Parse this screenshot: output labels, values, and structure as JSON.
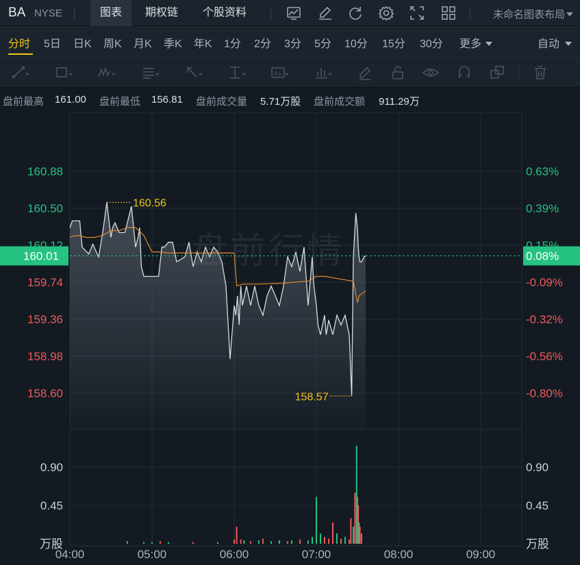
{
  "header": {
    "symbol": "BA",
    "exchange": "NYSE",
    "tabs": [
      "图表",
      "期权链",
      "个股资料"
    ],
    "active_tab": 0,
    "layout_name": "未命名图表布局"
  },
  "periods": {
    "items": [
      "分时",
      "5日",
      "日K",
      "周K",
      "月K",
      "季K",
      "年K",
      "1分",
      "2分",
      "3分",
      "5分",
      "10分",
      "15分",
      "30分"
    ],
    "more_label": "更多",
    "auto_label": "自动",
    "active": 0
  },
  "stats": {
    "high_label": "盘前最高",
    "high_value": "161.00",
    "low_label": "盘前最低",
    "low_value": "156.81",
    "vol_label": "盘前成交量",
    "vol_value": "5.71万股",
    "amount_label": "盘前成交额",
    "amount_value": "911.29万"
  },
  "chart": {
    "watermark": "盘前行情",
    "current_price_label": "160.01",
    "current_pct_label": "0.08%",
    "max_label": "160.56",
    "min_label": "158.57",
    "price_ticks": [
      "160.88",
      "160.50",
      "160.12",
      "159.74",
      "159.36",
      "158.98",
      "158.60"
    ],
    "pct_ticks": [
      "0.63%",
      "0.39%",
      "0.15%",
      "-0.09%",
      "-0.32%",
      "-0.56%",
      "-0.80%"
    ],
    "volume_ticks": [
      "0.90",
      "0.45"
    ],
    "volume_unit": "万股",
    "time_ticks": [
      "04:00",
      "05:00",
      "06:00",
      "07:00",
      "08:00",
      "09:00"
    ],
    "colors": {
      "up": "#26c281",
      "down": "#f05a5a",
      "accent": "#f0c419",
      "avg": "#e08a2e",
      "line": "#d9dde2"
    }
  },
  "chart_data": {
    "type": "line",
    "title": "",
    "xlabel": "",
    "ylabel": "",
    "ylim": [
      158.44,
      161.05
    ],
    "x_range_hours": [
      4.0,
      9.5
    ],
    "reference_price": 159.88,
    "series": [
      {
        "x": [
          4.0,
          4.03,
          4.12,
          4.15,
          4.23,
          4.28,
          4.35,
          4.4,
          4.45,
          4.5,
          4.52,
          4.55,
          4.6,
          4.67,
          4.75,
          4.8,
          4.83,
          4.85,
          4.87,
          4.9,
          5.0,
          5.08,
          5.12,
          5.15,
          5.2,
          5.25,
          5.3,
          5.4,
          5.45,
          5.5,
          5.55,
          5.6,
          5.65,
          5.7,
          5.75,
          5.8,
          5.85,
          5.9,
          5.95,
          6.0,
          6.02,
          6.04,
          6.06,
          6.08,
          6.1,
          6.15,
          6.2,
          6.25,
          6.3,
          6.35,
          6.4,
          6.45,
          6.5,
          6.55,
          6.6,
          6.65,
          6.7,
          6.75,
          6.8,
          6.85,
          6.9,
          6.95,
          6.97,
          7.0,
          7.02,
          7.05,
          7.1,
          7.12,
          7.15,
          7.2,
          7.25,
          7.3,
          7.35,
          7.4,
          7.43,
          7.45,
          7.48,
          7.5,
          7.51,
          7.52,
          7.53,
          7.55,
          7.58,
          7.6
        ],
        "values": [
          160.3,
          160.37,
          160.37,
          160.1,
          160.03,
          160.13,
          160.0,
          160.25,
          160.56,
          160.2,
          160.3,
          160.35,
          160.25,
          160.25,
          160.52,
          160.1,
          160.2,
          160.3,
          159.9,
          159.8,
          159.8,
          159.8,
          160.1,
          160.1,
          160.15,
          160.15,
          159.95,
          160.0,
          160.15,
          159.9,
          160.05,
          159.95,
          160.1,
          160.0,
          160.1,
          160.05,
          159.95,
          159.7,
          158.95,
          159.5,
          159.4,
          159.6,
          159.3,
          159.7,
          159.5,
          159.7,
          159.5,
          159.7,
          159.5,
          159.4,
          159.6,
          159.7,
          159.6,
          159.5,
          159.7,
          160.0,
          159.9,
          160.05,
          159.85,
          160.1,
          159.5,
          160.0,
          159.7,
          159.5,
          159.3,
          159.2,
          159.4,
          159.2,
          159.35,
          159.2,
          159.4,
          159.3,
          159.4,
          159.2,
          158.57,
          160.0,
          160.45,
          160.3,
          160.1,
          160.0,
          159.95,
          159.95,
          160.0,
          160.01
        ]
      },
      {
        "name": "avg",
        "x": [
          4.0,
          4.03,
          4.1,
          4.2,
          4.3,
          4.4,
          4.5,
          4.6,
          4.7,
          4.8,
          4.9,
          5.0,
          5.1,
          5.2,
          5.3,
          5.4,
          5.5,
          5.6,
          5.7,
          5.8,
          5.9,
          6.0,
          6.03,
          6.1,
          6.3,
          6.6,
          6.9,
          7.0,
          7.1,
          7.3,
          7.45,
          7.5,
          7.52,
          7.6
        ],
        "values": [
          160.2,
          160.21,
          160.22,
          160.2,
          160.2,
          160.22,
          160.27,
          160.27,
          160.3,
          160.3,
          160.22,
          160.05,
          160.05,
          160.04,
          160.04,
          160.04,
          160.04,
          160.04,
          160.04,
          160.04,
          160.04,
          160.04,
          159.7,
          159.72,
          159.72,
          159.73,
          159.75,
          159.8,
          159.8,
          159.77,
          159.75,
          159.53,
          159.6,
          159.65
        ]
      }
    ],
    "volume": {
      "x": [
        4.7,
        4.9,
        5.0,
        5.1,
        5.2,
        5.5,
        5.8,
        6.0,
        6.03,
        6.08,
        6.12,
        6.2,
        6.3,
        6.35,
        6.45,
        6.55,
        6.65,
        6.7,
        6.8,
        6.9,
        6.95,
        7.0,
        7.05,
        7.1,
        7.15,
        7.2,
        7.25,
        7.3,
        7.35,
        7.4,
        7.42,
        7.45,
        7.47,
        7.49,
        7.5,
        7.51,
        7.52,
        7.53,
        7.55
      ],
      "values": [
        0.03,
        0.02,
        0.02,
        0.03,
        0.02,
        0.02,
        0.02,
        0.05,
        0.2,
        0.05,
        0.04,
        0.03,
        0.04,
        0.06,
        0.03,
        0.04,
        0.03,
        0.04,
        0.05,
        0.04,
        0.08,
        0.55,
        0.12,
        0.08,
        0.06,
        0.25,
        0.12,
        0.06,
        0.08,
        0.05,
        0.3,
        0.2,
        0.6,
        1.15,
        0.55,
        0.45,
        0.25,
        0.2,
        0.12
      ],
      "directions": [
        "up",
        "up",
        "up",
        "down",
        "up",
        "down",
        "up",
        "down",
        "down",
        "down",
        "up",
        "down",
        "up",
        "down",
        "up",
        "up",
        "down",
        "up",
        "down",
        "up",
        "up",
        "up",
        "up",
        "down",
        "down",
        "down",
        "up",
        "down",
        "up",
        "down",
        "down",
        "up",
        "down",
        "up",
        "down",
        "down",
        "up",
        "down",
        "down"
      ]
    }
  }
}
